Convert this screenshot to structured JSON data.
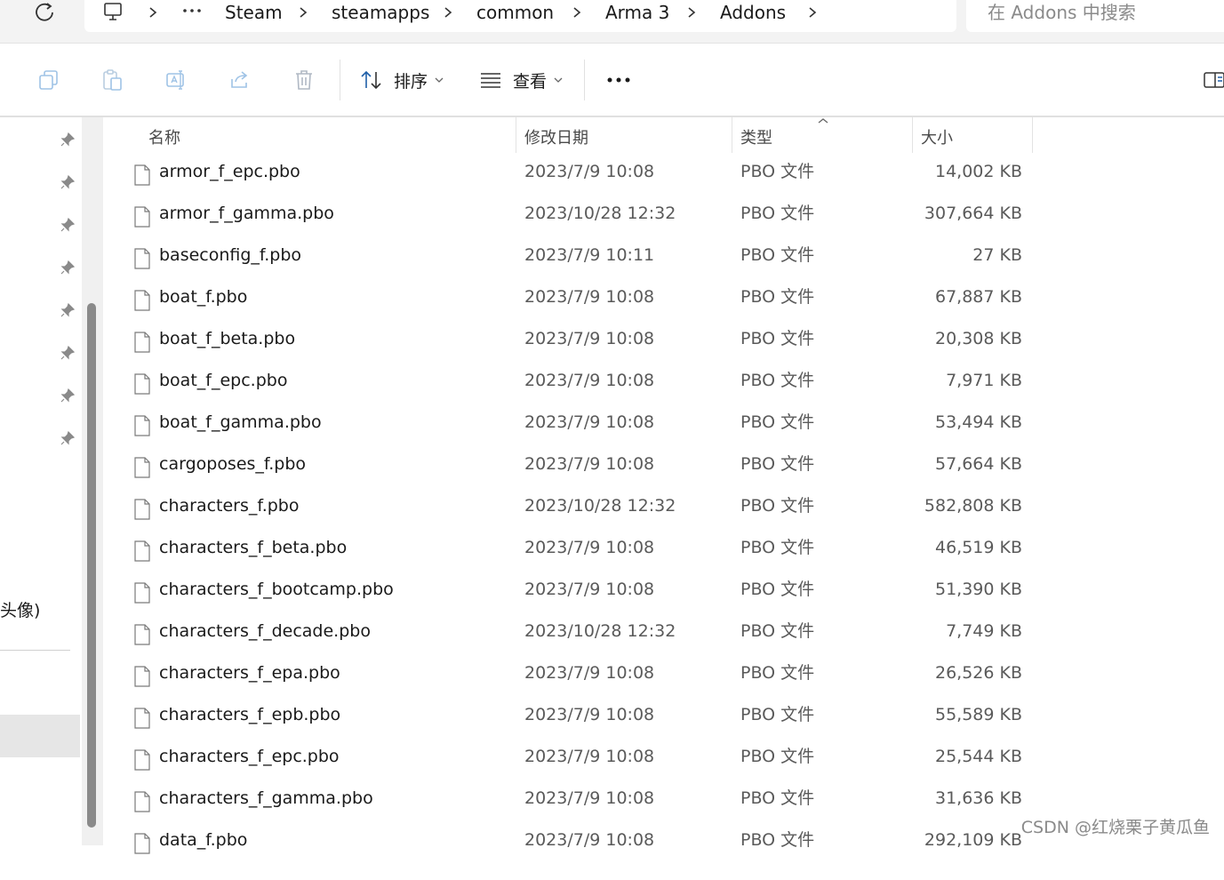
{
  "breadcrumbs": [
    "Steam",
    "steamapps",
    "common",
    "Arma 3",
    "Addons"
  ],
  "search": {
    "placeholder": "在 Addons 中搜索"
  },
  "toolbar": {
    "sort_label": "排序",
    "view_label": "查看"
  },
  "nav": {
    "visible_text": "头像)"
  },
  "columns": {
    "name": "名称",
    "date": "修改日期",
    "type": "类型",
    "size": "大小"
  },
  "files": [
    {
      "name": "armor_f_epc.pbo",
      "date": "2023/7/9 10:08",
      "type": "PBO 文件",
      "size": "14,002 KB"
    },
    {
      "name": "armor_f_gamma.pbo",
      "date": "2023/10/28 12:32",
      "type": "PBO 文件",
      "size": "307,664 KB"
    },
    {
      "name": "baseconfig_f.pbo",
      "date": "2023/7/9 10:11",
      "type": "PBO 文件",
      "size": "27 KB"
    },
    {
      "name": "boat_f.pbo",
      "date": "2023/7/9 10:08",
      "type": "PBO 文件",
      "size": "67,887 KB"
    },
    {
      "name": "boat_f_beta.pbo",
      "date": "2023/7/9 10:08",
      "type": "PBO 文件",
      "size": "20,308 KB"
    },
    {
      "name": "boat_f_epc.pbo",
      "date": "2023/7/9 10:08",
      "type": "PBO 文件",
      "size": "7,971 KB"
    },
    {
      "name": "boat_f_gamma.pbo",
      "date": "2023/7/9 10:08",
      "type": "PBO 文件",
      "size": "53,494 KB"
    },
    {
      "name": "cargoposes_f.pbo",
      "date": "2023/7/9 10:08",
      "type": "PBO 文件",
      "size": "57,664 KB"
    },
    {
      "name": "characters_f.pbo",
      "date": "2023/10/28 12:32",
      "type": "PBO 文件",
      "size": "582,808 KB"
    },
    {
      "name": "characters_f_beta.pbo",
      "date": "2023/7/9 10:08",
      "type": "PBO 文件",
      "size": "46,519 KB"
    },
    {
      "name": "characters_f_bootcamp.pbo",
      "date": "2023/7/9 10:08",
      "type": "PBO 文件",
      "size": "51,390 KB"
    },
    {
      "name": "characters_f_decade.pbo",
      "date": "2023/10/28 12:32",
      "type": "PBO 文件",
      "size": "7,749 KB"
    },
    {
      "name": "characters_f_epa.pbo",
      "date": "2023/7/9 10:08",
      "type": "PBO 文件",
      "size": "26,526 KB"
    },
    {
      "name": "characters_f_epb.pbo",
      "date": "2023/7/9 10:08",
      "type": "PBO 文件",
      "size": "55,589 KB"
    },
    {
      "name": "characters_f_epc.pbo",
      "date": "2023/7/9 10:08",
      "type": "PBO 文件",
      "size": "25,544 KB"
    },
    {
      "name": "characters_f_gamma.pbo",
      "date": "2023/7/9 10:08",
      "type": "PBO 文件",
      "size": "31,636 KB"
    },
    {
      "name": "data_f.pbo",
      "date": "2023/7/9 10:08",
      "type": "PBO 文件",
      "size": "292,109 KB"
    }
  ],
  "watermark": "CSDN @红烧栗子黄瓜鱼"
}
